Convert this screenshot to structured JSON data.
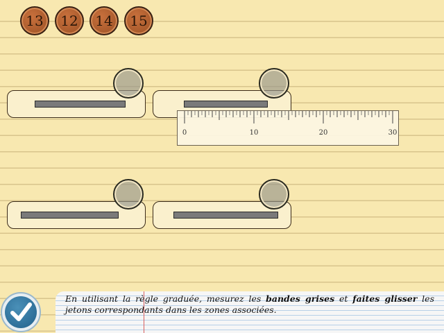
{
  "tokens": [
    {
      "label": "13"
    },
    {
      "label": "12"
    },
    {
      "label": "14"
    },
    {
      "label": "15"
    }
  ],
  "ruler": {
    "min": 0,
    "max": 30,
    "labels": [
      "0",
      "10",
      "20",
      "30"
    ]
  },
  "instructions": {
    "part1": "En utilisant la règle graduée, mesurez les ",
    "bold1": "bandes grises",
    "part2": " et ",
    "bold2": "faites glisser",
    "part3": " les jetons correspondants dans les zones associées."
  },
  "colors": {
    "paper": "#f8e8b0",
    "token": "#b0612f",
    "bar": "#7a7a7a",
    "check_button": "#2a6a94"
  },
  "icons": {
    "validate": "checkmark-icon"
  }
}
